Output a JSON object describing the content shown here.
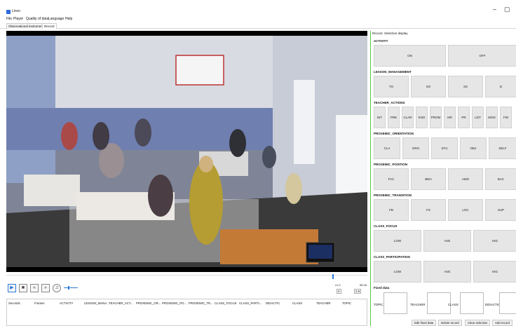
{
  "window": {
    "title": "Linco",
    "minimize": "–",
    "restore": "▢"
  },
  "menu": [
    "File",
    "Player",
    "Quality of data",
    "Language",
    "Help"
  ],
  "tabs": [
    "Observational instrument",
    "Record"
  ],
  "player": {
    "speed": "x1.0",
    "time": "55:18",
    "spin_a": "0",
    "spin_b": "0.5"
  },
  "table": {
    "headers": [
      "Seconds",
      "Frames",
      "ACTIVITY",
      "LESSON_MANA...",
      "TEACHER_ACT...",
      "PROXEMIC_OR...",
      "PROXEMIC_PO...",
      "PROXEMIC_TR...",
      "CLASS_FOCUS",
      "CLASS_PARTI...",
      "DIDACTIC",
      "CLASS",
      "TEACHER",
      "TOPIC"
    ]
  },
  "right_tabs": [
    "Record",
    "Selective display"
  ],
  "sections": {
    "activity": {
      "title": "ACTIVITY",
      "buttons": [
        "ON",
        "OFF"
      ]
    },
    "lesson": {
      "title": "LESSON_MANAGEMENT",
      "buttons": [
        "TO",
        "SO",
        "SS",
        "D"
      ]
    },
    "teacher": {
      "title": "TEACHER_ACTIONS",
      "buttons": [
        "INT",
        "PRE",
        "CLAR",
        "KNO",
        "PROM",
        "NR",
        "PR",
        "LDT",
        "MOD",
        "FW"
      ]
    },
    "orientation": {
      "title": "PROXEMIC_ORIENTATION",
      "buttons": [
        "CLA",
        "GRO",
        "STU",
        "OBJ",
        "SELF"
      ]
    },
    "position": {
      "title": "PROXEMIC_POSITION",
      "buttons": [
        "FAC",
        "BEH",
        "AMO",
        "BAC"
      ]
    },
    "transition": {
      "title": "PROXEMIC_TRANSITION",
      "buttons": [
        "FB",
        "FS",
        "LOC",
        "SUP"
      ]
    },
    "focus": {
      "title": "CLASS_FOCUS",
      "buttons": [
        "LOW",
        "AVE",
        "HIG"
      ]
    },
    "participation": {
      "title": "CLASS_PARTICIPATION",
      "buttons": [
        "LOW",
        "AVE",
        "HIG"
      ]
    }
  },
  "fixed": {
    "title": "Fixed data",
    "labels": [
      "TOPIC",
      "TEACHER",
      "CLASS",
      "DIDACTIC"
    ]
  },
  "actions": [
    "Edit fixed data",
    "Delete record",
    "Clear selection",
    "Add record"
  ]
}
